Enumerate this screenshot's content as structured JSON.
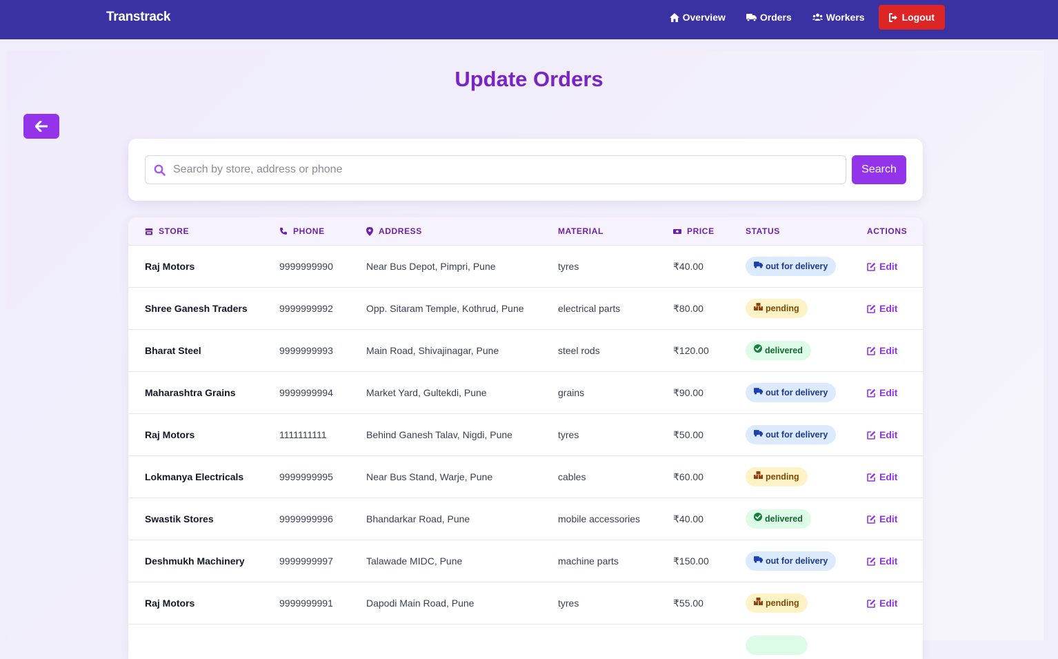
{
  "navbar": {
    "brand": "Transtrack",
    "links": [
      {
        "label": "Overview",
        "icon": "home-icon"
      },
      {
        "label": "Orders",
        "icon": "truck-icon"
      },
      {
        "label": "Workers",
        "icon": "users-icon"
      }
    ],
    "logout_label": "Logout"
  },
  "page": {
    "title": "Update Orders"
  },
  "search": {
    "placeholder": "Search by store, address or phone",
    "value": "",
    "button_label": "Search"
  },
  "table": {
    "headers": {
      "store": "STORE",
      "phone": "PHONE",
      "address": "ADDRESS",
      "material": "MATERIAL",
      "price": "PRICE",
      "status": "STATUS",
      "actions": "ACTIONS"
    },
    "edit_label": "Edit",
    "rows": [
      {
        "store": "Raj Motors",
        "phone": "9999999990",
        "address": "Near Bus Depot, Pimpri, Pune",
        "material": "tyres",
        "price": "₹40.00",
        "status": "out for delivery",
        "status_kind": "out"
      },
      {
        "store": "Shree Ganesh Traders",
        "phone": "9999999992",
        "address": "Opp. Sitaram Temple, Kothrud, Pune",
        "material": "electrical parts",
        "price": "₹80.00",
        "status": "pending",
        "status_kind": "pending"
      },
      {
        "store": "Bharat Steel",
        "phone": "9999999993",
        "address": "Main Road, Shivajinagar, Pune",
        "material": "steel rods",
        "price": "₹120.00",
        "status": "delivered",
        "status_kind": "delivered"
      },
      {
        "store": "Maharashtra Grains",
        "phone": "9999999994",
        "address": "Market Yard, Gultekdi, Pune",
        "material": "grains",
        "price": "₹90.00",
        "status": "out for delivery",
        "status_kind": "out"
      },
      {
        "store": "Raj Motors",
        "phone": "1111111111",
        "address": "Behind Ganesh Talav, Nigdi, Pune",
        "material": "tyres",
        "price": "₹50.00",
        "status": "out for delivery",
        "status_kind": "out"
      },
      {
        "store": "Lokmanya Electricals",
        "phone": "9999999995",
        "address": "Near Bus Stand, Warje, Pune",
        "material": "cables",
        "price": "₹60.00",
        "status": "pending",
        "status_kind": "pending"
      },
      {
        "store": "Swastik Stores",
        "phone": "9999999996",
        "address": "Bhandarkar Road, Pune",
        "material": "mobile accessories",
        "price": "₹40.00",
        "status": "delivered",
        "status_kind": "delivered"
      },
      {
        "store": "Deshmukh Machinery",
        "phone": "9999999997",
        "address": "Talawade MIDC, Pune",
        "material": "machine parts",
        "price": "₹150.00",
        "status": "out for delivery",
        "status_kind": "out"
      },
      {
        "store": "Raj Motors",
        "phone": "9999999991",
        "address": "Dapodi Main Road, Pune",
        "material": "tyres",
        "price": "₹55.00",
        "status": "pending",
        "status_kind": "pending"
      }
    ]
  },
  "colors": {
    "navbar": "#3a32a3",
    "accent": "#9333ea",
    "title": "#7a23c7",
    "logout": "#dc2626"
  }
}
